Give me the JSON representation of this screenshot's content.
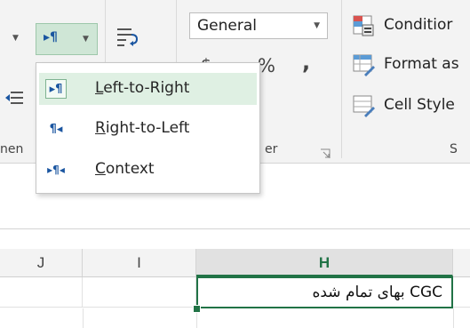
{
  "ribbon": {
    "paragraph_dropdown_label": "▸¶",
    "paragraph_menu": {
      "items": [
        {
          "glyph": "▸¶",
          "accel": "L",
          "rest": "eft-to-Right",
          "active": true
        },
        {
          "glyph": "¶◂",
          "accel": "R",
          "rest": "ight-to-Left",
          "active": false
        },
        {
          "glyph": "▸¶◂",
          "accel": "C",
          "rest": "ontext",
          "active": false
        }
      ]
    },
    "group_label_alignment_partial": "nen",
    "number": {
      "format_value": "General",
      "dollar_symbol": "$",
      "percent_symbol": "%",
      "comma_symbol": ",",
      "group_label_partial": "er"
    },
    "styles": {
      "conditional_label": "Conditior",
      "format_as_label": "Format as",
      "cell_styles_label": "Cell Style",
      "group_label_partial": "S"
    }
  },
  "sheet": {
    "columns": [
      {
        "label": "J",
        "selected": false
      },
      {
        "label": "I",
        "selected": false
      },
      {
        "label": "H",
        "selected": true
      }
    ],
    "active_cell_text": "CGC بهای تمام شده"
  },
  "colors": {
    "excel_green": "#217346",
    "menu_highlight": "#dff0e3",
    "ribbon_bg": "#f3f3f3"
  }
}
